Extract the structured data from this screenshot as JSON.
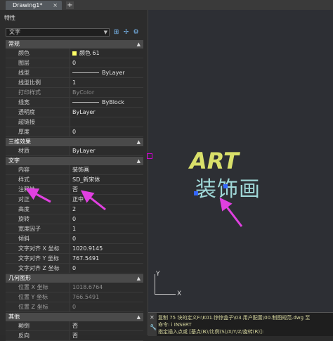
{
  "tabs": [
    {
      "label": "Drawing1*",
      "close": "×"
    }
  ],
  "tab_add": "+",
  "panel": {
    "title": "特性",
    "selector": "文字",
    "sections": [
      {
        "label": "常规",
        "rows": [
          {
            "key": "颜色",
            "value": "颜色 61",
            "swatch": "#ffff66"
          },
          {
            "key": "图层",
            "value": "0"
          },
          {
            "key": "线型",
            "value": "ByLayer",
            "line": true
          },
          {
            "key": "线型比例",
            "value": "1"
          },
          {
            "key": "打印样式",
            "value": "ByColor",
            "dim": true
          },
          {
            "key": "线宽",
            "value": "ByBlock",
            "line": true
          },
          {
            "key": "透明度",
            "value": "ByLayer"
          },
          {
            "key": "超链接",
            "value": ""
          },
          {
            "key": "厚度",
            "value": "0"
          }
        ]
      },
      {
        "label": "三维效果",
        "rows": [
          {
            "key": "材质",
            "value": "ByLayer"
          }
        ]
      },
      {
        "label": "文字",
        "rows": [
          {
            "key": "内容",
            "value": "装饰画"
          },
          {
            "key": "样式",
            "value": "SD_新宋体"
          },
          {
            "key": "注释性",
            "value": "否"
          },
          {
            "key": "对正",
            "value": "正中"
          },
          {
            "key": "高度",
            "value": "2"
          },
          {
            "key": "旋转",
            "value": "0"
          },
          {
            "key": "宽度因子",
            "value": "1"
          },
          {
            "key": "倾斜",
            "value": "0"
          },
          {
            "key": "文字对齐 X 坐标",
            "value": "1020.9145"
          },
          {
            "key": "文字对齐 Y 坐标",
            "value": "767.5491"
          },
          {
            "key": "文字对齐 Z 坐标",
            "value": "0"
          }
        ]
      },
      {
        "label": "几何图形",
        "rows": [
          {
            "key": "位置 X 坐标",
            "value": "1018.6764",
            "dim": true
          },
          {
            "key": "位置 Y 坐标",
            "value": "766.5491",
            "dim": true
          },
          {
            "key": "位置 Z 坐标",
            "value": "0",
            "dim": true
          }
        ]
      },
      {
        "label": "其他",
        "rows": [
          {
            "key": "颠倒",
            "value": "否"
          },
          {
            "key": "反向",
            "value": "否"
          }
        ]
      }
    ]
  },
  "canvas": {
    "art_text": "ART",
    "cn_text": "装饰画",
    "ucs_x": "X",
    "ucs_y": "Y"
  },
  "command": {
    "lines": [
      "复制 75 块的定义F:\\K01.惊惊盒子\\03.用户配置\\00.制图规范.dwg 至",
      "命令: i INSERT",
      "指定插入点或 [基点(B)/比例(S)/X/Y/Z/旋转(R)]:"
    ]
  },
  "colors": {
    "accent_arrow": "#e040e0",
    "grip": "#3366ff"
  }
}
